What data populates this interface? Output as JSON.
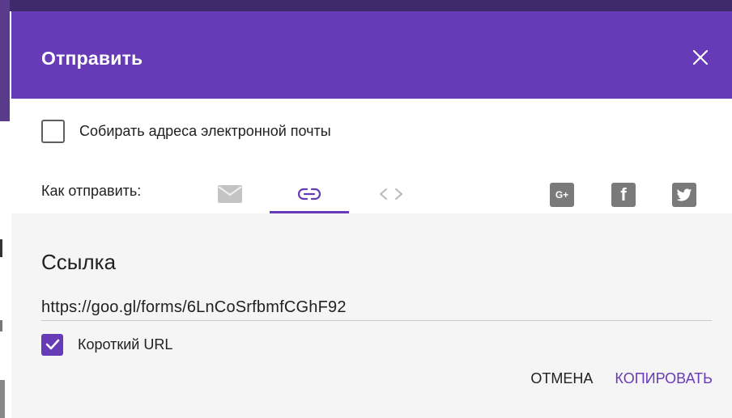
{
  "dialog": {
    "title": "Отправить",
    "close_icon": "close-icon"
  },
  "collect_emails": {
    "label": "Собирать адреса электронной почты",
    "checked": false
  },
  "send_via": {
    "label": "Как отправить:",
    "tabs": [
      {
        "name": "email",
        "icon": "mail-icon",
        "selected": false
      },
      {
        "name": "link",
        "icon": "link-icon",
        "selected": true
      },
      {
        "name": "embed",
        "icon": "embed-code-icon",
        "selected": false
      }
    ],
    "social": [
      {
        "name": "google-plus",
        "icon": "google-plus-icon",
        "glyph": "G+"
      },
      {
        "name": "facebook",
        "icon": "facebook-icon",
        "glyph": "f"
      },
      {
        "name": "twitter",
        "icon": "twitter-icon"
      }
    ]
  },
  "link_section": {
    "title": "Ссылка",
    "url": "https://goo.gl/forms/6LnCoSrfbmfCGhF92",
    "short_url_label": "Короткий URL",
    "short_url_checked": true
  },
  "actions": {
    "cancel_label": "ОТМЕНА",
    "copy_label": "КОПИРОВАТЬ"
  },
  "colors": {
    "accent": "#673ab7",
    "icon_gray": "#7a7a7a",
    "panel_bg": "#f5f5f5"
  }
}
